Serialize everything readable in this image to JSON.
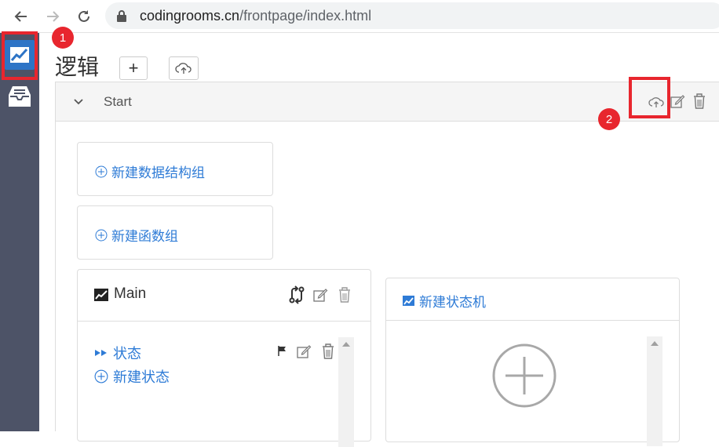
{
  "browser": {
    "url_host": "codingrooms.cn",
    "url_path": "/frontpage/index.html"
  },
  "page": {
    "title": "逻辑",
    "add_button": "+"
  },
  "panel": {
    "title": "Start"
  },
  "actions": {
    "new_struct_group": "新建数据结构组",
    "new_func_group": "新建函数组",
    "new_state_machine": "新建状态机"
  },
  "main_card": {
    "title": "Main",
    "states_label": "状态",
    "new_state_label": "新建状态"
  },
  "annotations": {
    "badge_1": "1",
    "badge_2": "2"
  },
  "colors": {
    "sidebar": "#4d5367",
    "accent": "#2e7bd6",
    "highlight": "#e8262e"
  }
}
